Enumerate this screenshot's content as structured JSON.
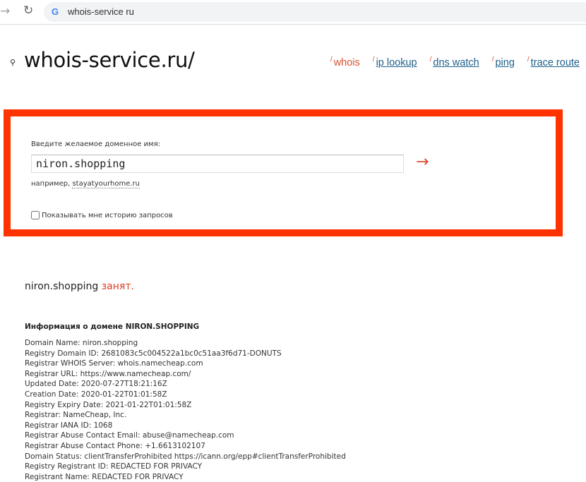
{
  "browser": {
    "url": "whois-service ru"
  },
  "header": {
    "title": "whois-service.ru/",
    "nav": [
      {
        "label": "whois",
        "active": true
      },
      {
        "label": "ip lookup"
      },
      {
        "label": "dns watch"
      },
      {
        "label": "ping"
      },
      {
        "label": "trace route"
      }
    ],
    "nav_prefix": "/"
  },
  "form": {
    "label": "Введите желаемое доменное имя:",
    "value": "niron.shopping",
    "submit_glyph": "→",
    "example_prefix": "например,",
    "example_link": "stayatyourhome.ru",
    "history_label": "Показывать мне историю запросов"
  },
  "result": {
    "domain": "niron.shopping",
    "status": "занят."
  },
  "info": {
    "heading": "Информация о домене NIRON.SHOPPING",
    "lines": [
      "Domain Name: niron.shopping",
      "Registry Domain ID: 2681083c5c004522a1bc0c51aa3f6d71-DONUTS",
      "Registrar WHOIS Server: whois.namecheap.com",
      "Registrar URL: https://www.namecheap.com/",
      "Updated Date: 2020-07-27T18:21:16Z",
      "Creation Date: 2020-01-22T01:01:58Z",
      "Registry Expiry Date: 2021-01-22T01:01:58Z",
      "Registrar: NameCheap, Inc.",
      "Registrar IANA ID: 1068",
      "Registrar Abuse Contact Email: abuse@namecheap.com",
      "Registrar Abuse Contact Phone: +1.6613102107",
      "Domain Status: clientTransferProhibited https://icann.org/epp#clientTransferProhibited",
      "Registry Registrant ID: REDACTED FOR PRIVACY",
      "Registrant Name: REDACTED FOR PRIVACY"
    ]
  },
  "colors": {
    "accent": "#ff3300",
    "link": "#1d5f8a",
    "busy": "#e03a1e"
  }
}
